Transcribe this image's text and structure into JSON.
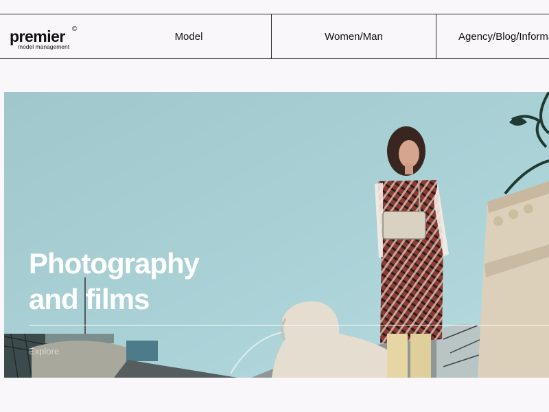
{
  "brand": {
    "name": "premier",
    "tagline": "model management",
    "mark": "©"
  },
  "nav": [
    {
      "label": "Model"
    },
    {
      "label": "Women/Man"
    },
    {
      "label": "Agency/Blog/Informations"
    }
  ],
  "hero": {
    "title_line1": "Photography",
    "title_line2": "and films",
    "cta": "Explore"
  },
  "colors": {
    "page_bg": "#f9f7f9",
    "sky": "#a6cdd3",
    "text": "#111111",
    "title": "#ffffff"
  }
}
